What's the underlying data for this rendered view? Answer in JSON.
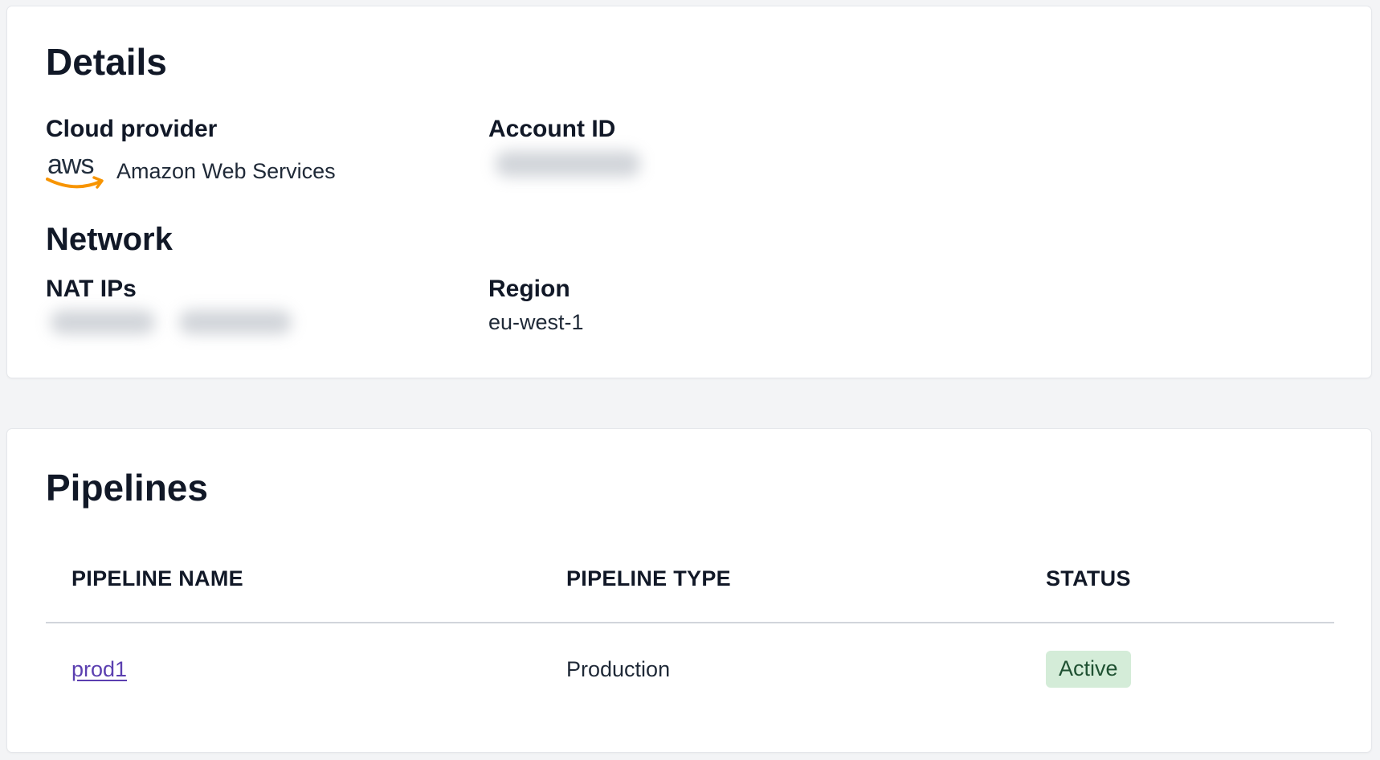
{
  "details": {
    "title": "Details",
    "cloud_provider": {
      "label": "Cloud provider",
      "logo_icon": "aws-logo-icon",
      "logo_text": "aws",
      "value": "Amazon Web Services"
    },
    "account_id": {
      "label": "Account ID",
      "value_redacted": true
    }
  },
  "network": {
    "title": "Network",
    "nat_ips": {
      "label": "NAT IPs",
      "value_redacted": true
    },
    "region": {
      "label": "Region",
      "value": "eu-west-1"
    }
  },
  "pipelines": {
    "title": "Pipelines",
    "columns": [
      "PIPELINE NAME",
      "PIPELINE TYPE",
      "STATUS"
    ],
    "rows": [
      {
        "name": "prod1",
        "type": "Production",
        "status": "Active"
      }
    ]
  },
  "colors": {
    "background": "#f3f4f6",
    "card": "#ffffff",
    "link": "#5b3fb0",
    "badge_bg": "#d4ecd8",
    "badge_text": "#1f5132",
    "aws_orange": "#f79400"
  }
}
